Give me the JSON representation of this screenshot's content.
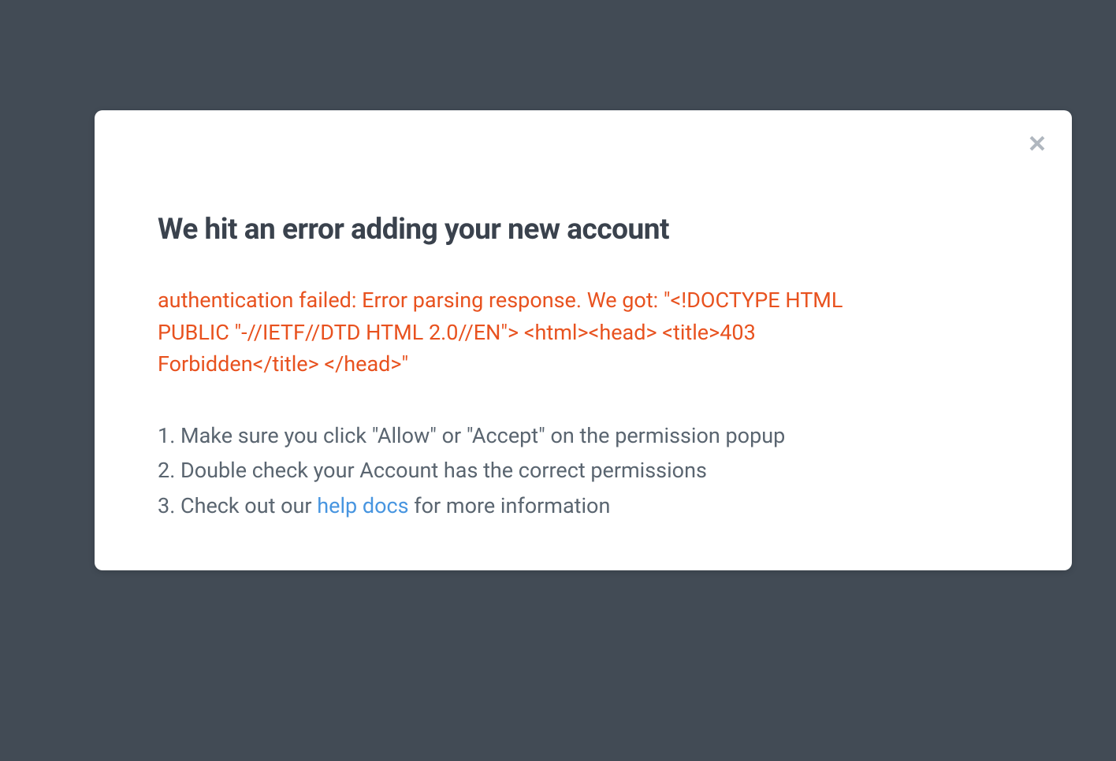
{
  "modal": {
    "title": "We hit an error adding your new account",
    "error_message": "authentication failed: Error parsing response. We got: \"<!DOCTYPE HTML PUBLIC \"-//IETF//DTD HTML 2.0//EN\"> <html><head> <title>403 Forbidden</title> </head>\"",
    "steps": [
      {
        "text_before": "Make sure you click \"Allow\" or \"Accept\" on the permission popup",
        "link_text": "",
        "text_after": ""
      },
      {
        "text_before": "Double check your Account has the correct permissions",
        "link_text": "",
        "text_after": ""
      },
      {
        "text_before": "Check out our ",
        "link_text": "help docs",
        "text_after": " for more information"
      }
    ]
  }
}
